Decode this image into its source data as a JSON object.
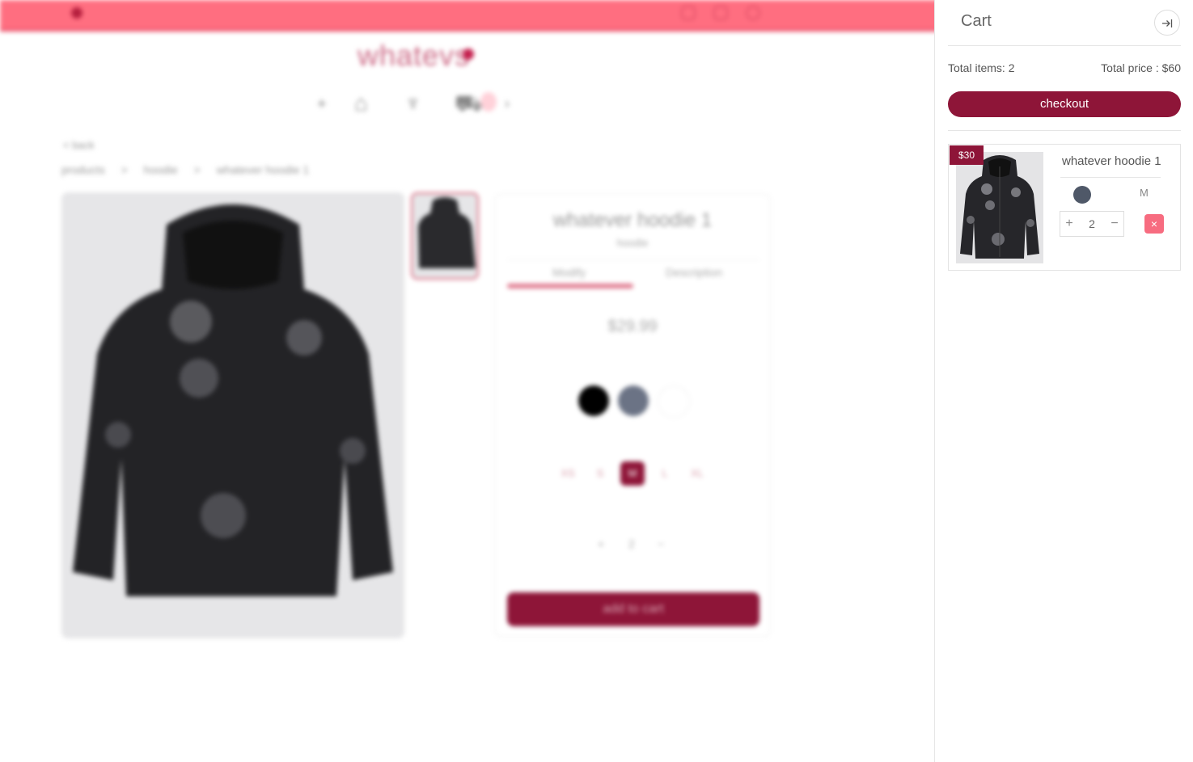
{
  "background": {
    "logo": "whatevs",
    "back_label": "< back",
    "breadcrumb": [
      "products",
      ">",
      "hoodie",
      ">",
      "whatever hoodie 1"
    ],
    "product": {
      "title": "whatever hoodie 1",
      "category": "hoodie",
      "tabs": [
        "Modify",
        "Description"
      ],
      "price": "$29.99",
      "swatches": [
        "#000000",
        "#6b7385",
        "#ffffff"
      ],
      "sizes": [
        "XS",
        "S",
        "M",
        "L",
        "XL"
      ],
      "selected_size": "M",
      "quantity": "2",
      "add_label": "add to cart"
    }
  },
  "colors": {
    "accent": "#8e1538",
    "topbar": "#ff6e80",
    "remove": "#f76c80"
  },
  "cart": {
    "title": "Cart",
    "close_icon": "collapse-right-icon",
    "total_items_label": "Total items: 2",
    "total_price_label": "Total price : $60",
    "checkout_label": "checkout",
    "items": [
      {
        "price_badge": "$30",
        "name": "whatever hoodie 1",
        "color": "#4f5868",
        "size": "M",
        "quantity": "2",
        "plus_glyph": "+",
        "minus_glyph": "−",
        "remove_glyph": "×"
      }
    ]
  }
}
